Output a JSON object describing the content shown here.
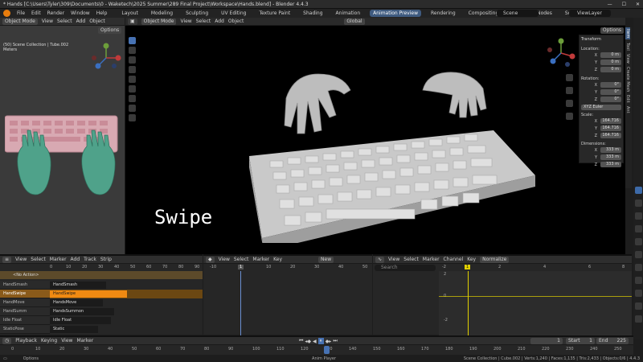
{
  "titlebar": {
    "title": "* Hands [C:\\Users\\Tyler\\309\\Documents\\0 - Waketech\\2025 Summer\\289 Final Project\\Workspace\\Hands.blend] - Blender 4.4.3"
  },
  "menubar": {
    "menus": [
      "File",
      "Edit",
      "Render",
      "Window",
      "Help"
    ],
    "workspaces": [
      "Layout",
      "Modeling",
      "Sculpting",
      "UV Editing",
      "Texture Paint",
      "Shading",
      "Animation",
      "Animation Preview",
      "Rendering",
      "Compositing",
      "Geometry Nodes",
      "Scripting"
    ],
    "active_workspace": "Animation Preview",
    "scene": "Scene",
    "view_layer": "ViewLayer"
  },
  "left_view": {
    "mode": "Object Mode",
    "menus": [
      "View",
      "Select",
      "Add",
      "Object"
    ],
    "options": "Options",
    "overlay_line1": "(50) Scene Collection | Tube.002",
    "overlay_line2": "Meters"
  },
  "main_view": {
    "mode": "Object Mode",
    "menus": [
      "View",
      "Select",
      "Add",
      "Object"
    ],
    "transform_orientation": "Global",
    "options": "Options",
    "caption": "Swipe"
  },
  "npanel": {
    "title": "Transform",
    "tabs": [
      "Item",
      "Tool",
      "View",
      "Create Mesh",
      "Edit",
      "Ant"
    ],
    "location_label": "Location:",
    "location": [
      {
        "axis": "X",
        "value": "0 m"
      },
      {
        "axis": "Y",
        "value": "0 m"
      },
      {
        "axis": "Z",
        "value": "0 m"
      }
    ],
    "rotation_label": "Rotation:",
    "rotation": [
      {
        "axis": "X",
        "value": "0°"
      },
      {
        "axis": "Y",
        "value": "0°"
      },
      {
        "axis": "Z",
        "value": "0°"
      }
    ],
    "rotation_mode": "XYZ Euler",
    "scale_label": "Scale:",
    "scale": [
      {
        "axis": "X",
        "value": "164.716"
      },
      {
        "axis": "Y",
        "value": "164.716"
      },
      {
        "axis": "Z",
        "value": "164.716"
      }
    ],
    "dimensions_label": "Dimensions:",
    "dimensions": [
      {
        "axis": "X",
        "value": "333 m"
      },
      {
        "axis": "Y",
        "value": "333 m"
      },
      {
        "axis": "Z",
        "value": "333 m"
      }
    ]
  },
  "nla": {
    "menus": [
      "View",
      "Select",
      "Marker",
      "Add",
      "Track",
      "Strip"
    ],
    "ruler": [
      "0",
      "10",
      "20",
      "30",
      "40",
      "50",
      "60",
      "70",
      "80",
      "90"
    ],
    "action_header": "<No Action>",
    "tracks": [
      {
        "name": "HandSmash",
        "strip": "HandSmash",
        "selected": false
      },
      {
        "name": "HandSwipe",
        "strip": "HandSwipe",
        "selected": true
      },
      {
        "name": "HandMove",
        "strip": "HandsMove",
        "selected": false
      },
      {
        "name": "HandSumm",
        "strip": "HandsSummon",
        "selected": false
      },
      {
        "name": "Idle Float",
        "strip": "Idle Float",
        "selected": false
      },
      {
        "name": "StaticPose",
        "strip": "Static",
        "selected": false
      }
    ]
  },
  "dopesheet": {
    "menus": [
      "View",
      "Select",
      "Marker",
      "Key"
    ],
    "new_label": "New",
    "ruler": [
      "-10",
      "0",
      "10",
      "20",
      "30",
      "40",
      "50"
    ],
    "current_frame": "1"
  },
  "graph": {
    "menus": [
      "View",
      "Select",
      "Marker",
      "Channel",
      "Key"
    ],
    "normalize": "Normalize",
    "search_placeholder": "Search",
    "ruler": [
      "-2",
      "0",
      "2",
      "4",
      "6",
      "8"
    ],
    "current_frame": "1",
    "yticks": [
      "2",
      "0",
      "-2"
    ]
  },
  "timeline": {
    "menus": [
      "Playback",
      "Keying",
      "View",
      "Marker"
    ],
    "current_frame": "1",
    "start_label": "Start",
    "start": "1",
    "end_label": "End",
    "end": "225",
    "ruler": [
      "0",
      "10",
      "20",
      "30",
      "40",
      "50",
      "60",
      "70",
      "80",
      "90",
      "100",
      "110",
      "120",
      "130",
      "140",
      "150",
      "160",
      "170",
      "180",
      "190",
      "200",
      "210",
      "220",
      "230",
      "240",
      "250"
    ]
  },
  "statusbar": {
    "options": "Options",
    "center": "Anim Player",
    "right": "Scene Collection | Cube.002 | Verts:1,240 | Faces:1,135 | Tris:2,433 | Objects:0/6 | 4.4.3"
  }
}
